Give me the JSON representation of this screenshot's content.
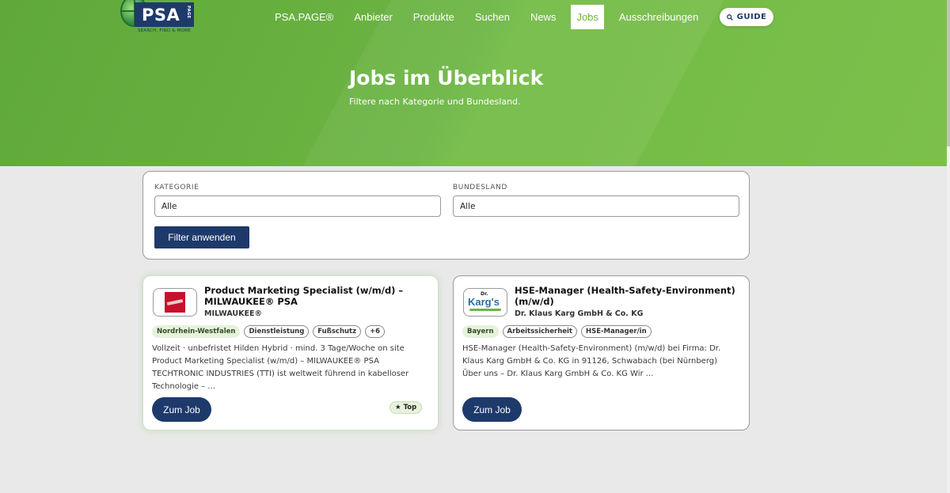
{
  "brand": {
    "logo_text": "PSA",
    "logo_page": "PAGE",
    "tagline": "SEARCH, FIND & MORE"
  },
  "nav": {
    "items": [
      {
        "label": "PSA.PAGE®"
      },
      {
        "label": "Anbieter"
      },
      {
        "label": "Produkte"
      },
      {
        "label": "Suchen"
      },
      {
        "label": "News"
      },
      {
        "label": "Jobs"
      },
      {
        "label": "Ausschreibungen"
      }
    ],
    "active": "Jobs",
    "guide_label": "GUIDE",
    "guide_icon": "search-icon"
  },
  "hero": {
    "title": "Jobs im Überblick",
    "subtitle": "Filtere nach Kategorie und Bundesland."
  },
  "filter": {
    "kategorie_label": "KATEGORIE",
    "kategorie_value": "Alle",
    "bundesland_label": "BUNDESLAND",
    "bundesland_value": "Alle",
    "button_label": "Filter anwenden"
  },
  "jobs": [
    {
      "title": "Product Marketing Specialist (w/m/d) – MILWAUKEE® PSA",
      "company": "MILWAUKEE®",
      "logo": "milwaukee-logo",
      "tags": [
        "Nordrhein-Westfalen",
        "Dienstleistung",
        "Fußschutz",
        "+6"
      ],
      "description": "Vollzeit · unbefristet Hilden Hybrid · mind. 3 Tage/Woche on site Product Marketing Specialist (w/m/d) – MILWAUKEE® PSA TECHTRONIC INDUSTRIES (TTI) ist weltweit führend in kabelloser Technologie – ...",
      "button_label": "Zum Job",
      "badge": "★ Top"
    },
    {
      "title": "HSE-Manager (Health-Safety-Environment) (m/w/d)",
      "company": "Dr. Klaus Karg GmbH & Co. KG",
      "logo": "karg-logo",
      "logo_dr": "Dr.",
      "logo_name": "Karg's",
      "tags": [
        "Bayern",
        "Arbeitssicherheit",
        "HSE-Manager/in"
      ],
      "description": "HSE-Manager (Health-Safety-Environment) (m/w/d) bei Firma: Dr. Klaus Karg GmbH & Co. KG in 91126, Schwabach (bei Nürnberg) Über uns – Dr. Klaus Karg GmbH & Co. KG Wir ...",
      "button_label": "Zum Job"
    }
  ],
  "colors": {
    "brand_green": "#6cb543",
    "navy": "#1e3a6b",
    "page_bg": "#e9e9e9"
  }
}
